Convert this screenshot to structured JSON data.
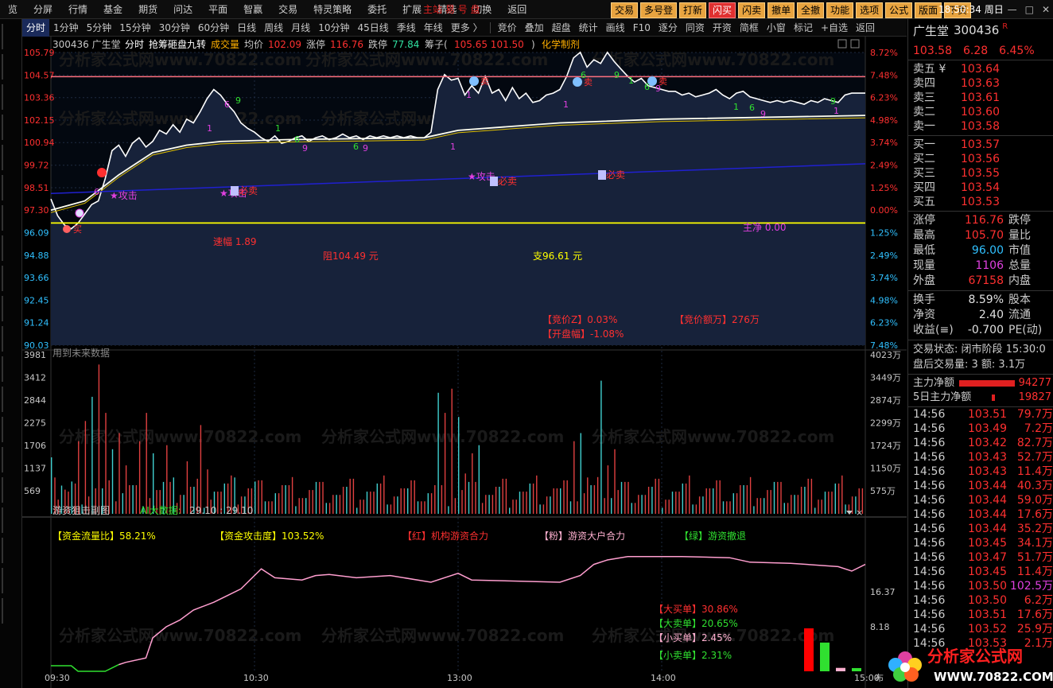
{
  "menu": [
    "览",
    "分屏",
    "行情",
    "基金",
    "期货",
    "问达",
    "平面",
    "智赢",
    "交易",
    "特灵策略",
    "委托",
    "扩展",
    "精选",
    "切换",
    "返回"
  ],
  "overlay_red": "主站 易 号 盘",
  "quick_buttons": [
    {
      "label": "交易",
      "red": false
    },
    {
      "label": "多号登",
      "red": false
    },
    {
      "label": "打新",
      "red": false
    },
    {
      "label": "闪买",
      "red": true
    },
    {
      "label": "闪卖",
      "red": false
    },
    {
      "label": "撤单",
      "red": false
    },
    {
      "label": "全撤",
      "red": false
    },
    {
      "label": "功能",
      "red": false
    },
    {
      "label": "选项",
      "red": false
    },
    {
      "label": "公式",
      "red": false
    },
    {
      "label": "版面",
      "red": false
    },
    {
      "label": "下页",
      "red": false
    }
  ],
  "clock": "18:50:34 周日",
  "window_buttons": [
    "—",
    "□",
    "✕"
  ],
  "period_tabs": [
    "分时",
    "1分钟",
    "5分钟",
    "15分钟",
    "30分钟",
    "60分钟",
    "日线",
    "周线",
    "月线",
    "10分钟",
    "45日线",
    "季线",
    "年线",
    "更多 〉"
  ],
  "tool_tabs": [
    "竞价",
    "叠加",
    "超盘",
    "统计",
    "画线",
    "F10",
    "逐分",
    "同资",
    "开资",
    "简框",
    "小窗",
    "标记",
    "+自选",
    "返回"
  ],
  "chart_header": {
    "code": "300436 广生堂",
    "type": "分时",
    "indicator": "抢筹砸盘九转",
    "vol": "成交量",
    "avg_label": "均价",
    "avg": "102.09",
    "up_label": "涨停",
    "up": "116.76",
    "down_label": "跌停",
    "down": "77.84",
    "chip_label": "筹子(",
    "chip": "105.65 101.50",
    "chip_close": ")",
    "sector": "化学制剂"
  },
  "price_axis": [
    "105.79",
    "104.57",
    "103.36",
    "102.15",
    "100.94",
    "99.72",
    "98.51",
    "97.30",
    "96.09",
    "94.88",
    "93.66",
    "92.45",
    "91.24",
    "90.03"
  ],
  "pct_axis": [
    "8.72%",
    "7.48%",
    "6.23%",
    "4.98%",
    "3.74%",
    "2.49%",
    "1.25%",
    "0.00%",
    "1.25%",
    "2.49%",
    "3.74%",
    "4.98%",
    "6.23%",
    "7.48%"
  ],
  "vol_axis_left": [
    "3981",
    "3412",
    "2844",
    "2275",
    "1706",
    "1137",
    "569"
  ],
  "vol_axis_right": [
    "4023万",
    "3449万",
    "2874万",
    "2299万",
    "1724万",
    "1150万",
    "575万"
  ],
  "time_axis": [
    "09:30",
    "10:30",
    "13:00",
    "14:00",
    "15:00"
  ],
  "time_axis_trailing": "布",
  "annotations": {
    "speed": "速幅 1.89",
    "resist": "阻104.49 元",
    "support": "支96.61 元",
    "main_net": "主净 0.00",
    "auction_z": "【竞价Z】0.03%",
    "auction_amt": "【竞价额万】276万",
    "open_gap": "【开盘幅】-1.08%",
    "future": "用到未来数据",
    "buy": "买",
    "sell": "卖",
    "attack": "★攻击",
    "must_sell": "必卖"
  },
  "sub_chart": {
    "title": "游资狙击副图",
    "ai_label": "AI大数据:",
    "ai_value": "29.10 : 29.10",
    "flow_ratio": "【资金流量比】58.21%",
    "attack": "【资金攻击度】103.52%",
    "red_legend": "【红】机构游资合力",
    "pink_legend": "【粉】游资大户合力",
    "green_legend": "【绿】游资撤退",
    "axis": [
      "16.37",
      "8.18"
    ],
    "big_buy": "【大买单】30.86%",
    "big_sell": "【大卖单】20.65%",
    "small_buy": "【小买单】2.45%",
    "small_sell": "【小卖单】2.31%"
  },
  "right_panel": {
    "name": "广生堂",
    "code": "300436",
    "r_mark": "R",
    "price": "103.58",
    "change": "6.28",
    "change_pct": "6.45%",
    "asks": [
      {
        "label": "卖五 ¥",
        "price": "103.64"
      },
      {
        "label": "卖四",
        "price": "103.63"
      },
      {
        "label": "卖三",
        "price": "103.61"
      },
      {
        "label": "卖二",
        "price": "103.60"
      },
      {
        "label": "卖一",
        "price": "103.58"
      }
    ],
    "bids": [
      {
        "label": "买一",
        "price": "103.57"
      },
      {
        "label": "买二",
        "price": "103.56"
      },
      {
        "label": "买三",
        "price": "103.55"
      },
      {
        "label": "买四",
        "price": "103.54"
      },
      {
        "label": "买五",
        "price": "103.53"
      }
    ],
    "stats": [
      {
        "l": "涨停",
        "v": "116.76",
        "c": "#ff3030",
        "l2": "跌停"
      },
      {
        "l": "最高",
        "v": "105.70",
        "c": "#ff3030",
        "l2": "量比"
      },
      {
        "l": "最低",
        "v": "96.00",
        "c": "#30c0ff",
        "l2": "市值"
      },
      {
        "l": "现量",
        "v": "1106",
        "c": "#e040e0",
        "l2": "总量"
      },
      {
        "l": "外盘",
        "v": "67158",
        "c": "#ff3030",
        "l2": "内盘"
      }
    ],
    "stats2": [
      {
        "l": "换手",
        "v": "8.59%",
        "c": "#e0e0e0",
        "l2": "股本"
      },
      {
        "l": "净资",
        "v": "2.40",
        "c": "#e0e0e0",
        "l2": "流通"
      },
      {
        "l": "收益(≡)",
        "v": "-0.700",
        "c": "#e0e0e0",
        "l2": "PE(动)"
      }
    ],
    "trade_status": "交易状态: 闭市阶段 15:30:0",
    "after_hours": "盘后交易量: 3  额: 3.1万",
    "main_net_label": "主力净额",
    "main_net_value": "94277",
    "main_net_5d_label": "5日主力净额",
    "main_net_5d_value": "19827",
    "ticks": [
      {
        "t": "14:56",
        "p": "103.51",
        "q": "79.7万"
      },
      {
        "t": "14:56",
        "p": "103.49",
        "q": "7.2万"
      },
      {
        "t": "14:56",
        "p": "103.42",
        "q": "82.7万"
      },
      {
        "t": "14:56",
        "p": "103.43",
        "q": "52.7万"
      },
      {
        "t": "14:56",
        "p": "103.43",
        "q": "11.4万"
      },
      {
        "t": "14:56",
        "p": "103.44",
        "q": "40.3万"
      },
      {
        "t": "14:56",
        "p": "103.44",
        "q": "59.0万"
      },
      {
        "t": "14:56",
        "p": "103.44",
        "q": "17.6万"
      },
      {
        "t": "14:56",
        "p": "103.44",
        "q": "35.2万"
      },
      {
        "t": "14:56",
        "p": "103.45",
        "q": "34.1万"
      },
      {
        "t": "14:56",
        "p": "103.47",
        "q": "51.7万"
      },
      {
        "t": "14:56",
        "p": "103.45",
        "q": "11.4万"
      },
      {
        "t": "14:56",
        "p": "103.50",
        "q": "102.5万"
      },
      {
        "t": "14:56",
        "p": "103.50",
        "q": "6.2万"
      },
      {
        "t": "14:56",
        "p": "103.51",
        "q": "17.6万"
      },
      {
        "t": "14:56",
        "p": "103.52",
        "q": "25.9万"
      },
      {
        "t": "14:56",
        "p": "103.53",
        "q": "2.1万"
      }
    ]
  },
  "watermark": "分析家公式网www.70822.com",
  "logo_text": "分析家公式网",
  "logo_url": "WWW.70822.COM",
  "colors": {
    "up": "#ff3030",
    "down": "#30c0ff",
    "yellow": "#ffff00",
    "pink": "#ff9ecf",
    "green": "#30e030",
    "blue": "#1010c0"
  }
}
